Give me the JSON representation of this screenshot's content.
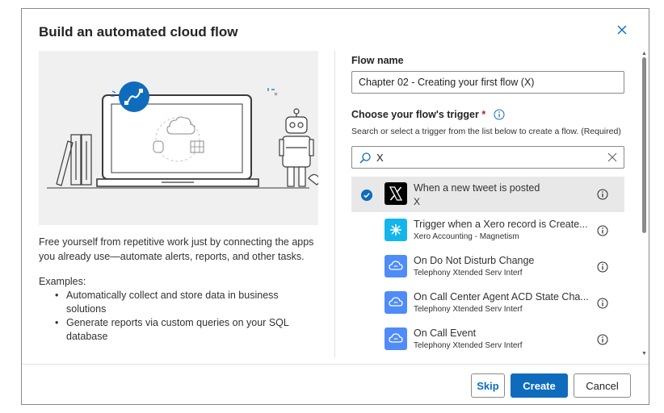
{
  "dialog": {
    "title": "Build an automated cloud flow",
    "close_icon": "close-icon"
  },
  "left": {
    "description": "Free yourself from repetitive work just by connecting the apps you already use—automate alerts, reports, and other tasks.",
    "examples_label": "Examples:",
    "examples": [
      "Automatically collect and store data in business solutions",
      "Generate reports via custom queries on your SQL database"
    ]
  },
  "form": {
    "flow_name_label": "Flow name",
    "flow_name_value": "Chapter 02 - Creating your first flow (X)",
    "trigger_label": "Choose your flow's trigger",
    "required_marker": "*",
    "trigger_hint": "Search or select a trigger from the list below to create a flow. (Required)",
    "search_value": "X"
  },
  "triggers": [
    {
      "name": "When a new tweet is posted",
      "connector": "X",
      "selected": true,
      "icon": "x-logo-icon",
      "color": "#000000"
    },
    {
      "name": "Trigger when a Xero record is Create...",
      "connector": "Xero Accounting - Magnetism",
      "selected": false,
      "icon": "xero-icon",
      "color": "#13b5ea"
    },
    {
      "name": "On Do Not Disturb Change",
      "connector": "Telephony Xtended Serv Interf",
      "selected": false,
      "icon": "cloud-connector-icon",
      "color": "#4f8cf7"
    },
    {
      "name": "On Call Center Agent ACD State Cha...",
      "connector": "Telephony Xtended Serv Interf",
      "selected": false,
      "icon": "cloud-connector-icon",
      "color": "#4f8cf7"
    },
    {
      "name": "On Call Event",
      "connector": "Telephony Xtended Serv Interf",
      "selected": false,
      "icon": "cloud-connector-icon",
      "color": "#4f8cf7"
    }
  ],
  "footer": {
    "skip_label": "Skip",
    "create_label": "Create",
    "cancel_label": "Cancel"
  },
  "colors": {
    "accent": "#0f6cbd"
  }
}
